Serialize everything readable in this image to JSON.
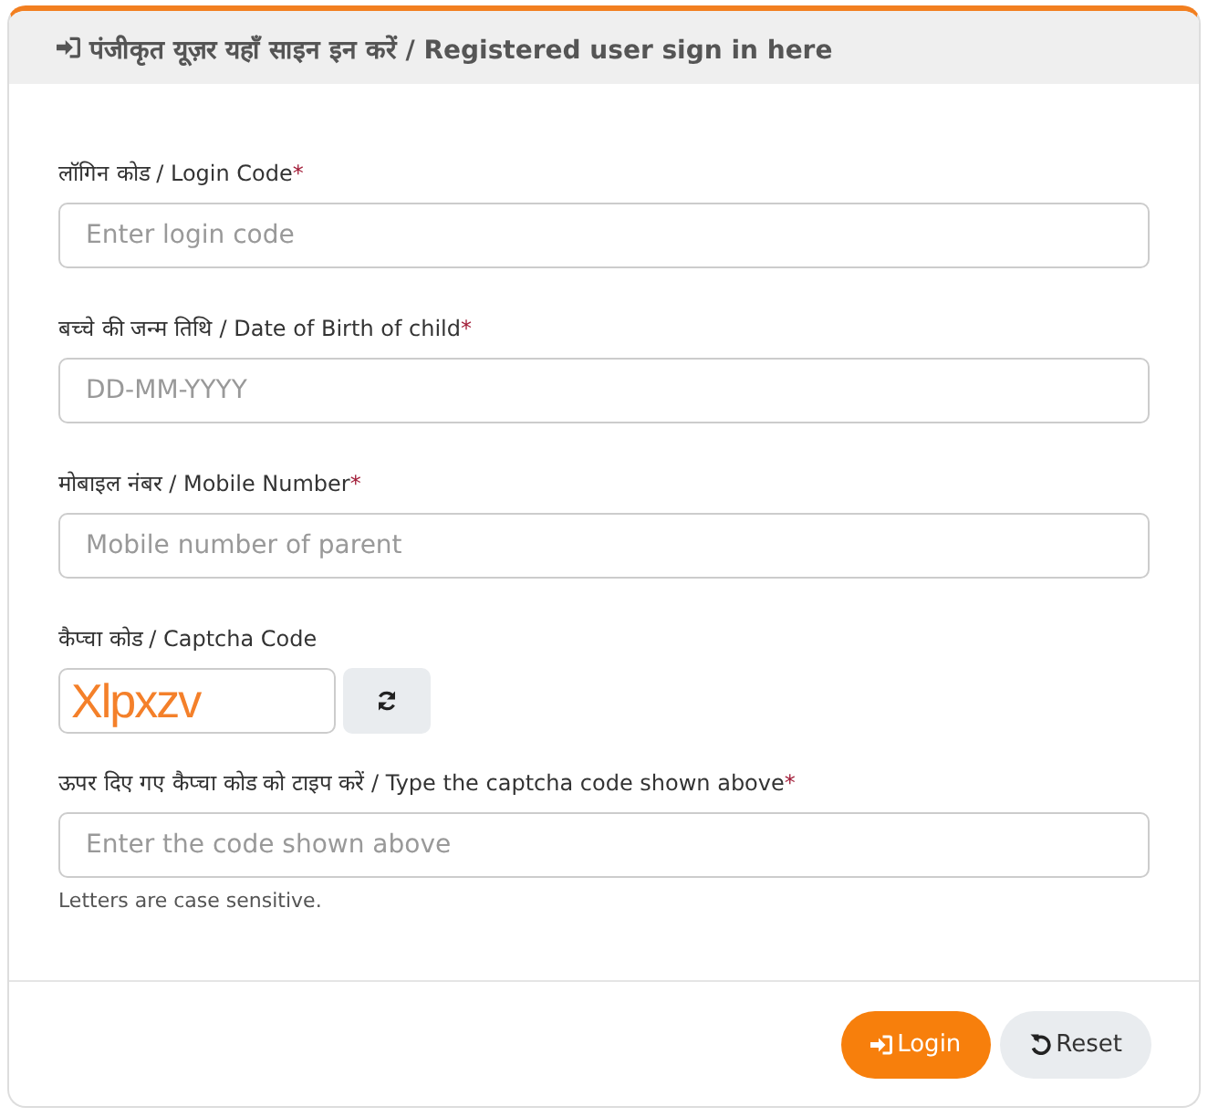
{
  "card": {
    "title": "पंजीकृत यूज़र यहाँ साइन इन करें / Registered user sign in here"
  },
  "fields": [
    {
      "kind": "text",
      "label": "लॉगिन कोड / Login Code",
      "required_mark": "*",
      "placeholder": "Enter login code"
    },
    {
      "kind": "text",
      "label": "बच्चे की जन्म तिथि / Date of Birth of child",
      "required_mark": "*",
      "placeholder": "DD-MM-YYYY"
    },
    {
      "kind": "text",
      "label": "मोबाइल नंबर / Mobile Number",
      "required_mark": "*",
      "placeholder": "Mobile number of parent"
    },
    {
      "kind": "captcha",
      "label": "कैप्चा कोड / Captcha Code",
      "captcha": "Xlpxzv"
    },
    {
      "kind": "text",
      "label": "ऊपर दिए गए कैप्चा कोड को टाइप करें / Type the captcha code shown above",
      "required_mark": "*",
      "placeholder": "Enter the code shown above",
      "help": "Letters are case sensitive."
    }
  ],
  "buttons": [
    {
      "kind": "primary",
      "label": "Login"
    },
    {
      "kind": "secondary",
      "label": "Reset"
    }
  ]
}
